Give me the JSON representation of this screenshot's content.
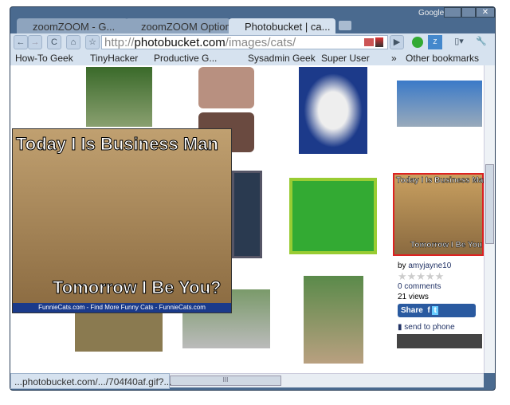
{
  "window": {
    "google_label": "Google",
    "controls": [
      "minimize",
      "maximize",
      "close"
    ]
  },
  "tabs": [
    {
      "label": "zoomZOOM - G...",
      "active": false
    },
    {
      "label": "zoomZOOM Options",
      "active": false
    },
    {
      "label": "Photobucket | ca...",
      "active": true
    }
  ],
  "address": {
    "scheme": "http://",
    "domain": "photobucket.com",
    "path": "/images/cats/"
  },
  "bookmarks": [
    {
      "label": "How-To Geek"
    },
    {
      "label": "TinyHacker"
    },
    {
      "label": "Productive G..."
    },
    {
      "label": "Sysadmin Geek"
    },
    {
      "label": "Super User"
    }
  ],
  "other_bookmarks": "Other bookmarks",
  "chevron": "»",
  "popup": {
    "top_text": "Today I Is Business Man",
    "bottom_text": "Tomorrow I Be You?",
    "caption": "FunnieCats.com - Find More Funny Cats - FunnieCats.com"
  },
  "selected": {
    "top_text": "Today I Is Business Man",
    "bottom_text": "Tomorrow I Be You",
    "by_label": "by",
    "author": "amyjayne10",
    "rating": 0,
    "comments": "0 comments",
    "views": "21 views",
    "share_label": "Share",
    "send_to_phone": "send to phone"
  },
  "status": "...photobucket.com/.../704f40af.gif?...",
  "hscroll_grip": "III"
}
